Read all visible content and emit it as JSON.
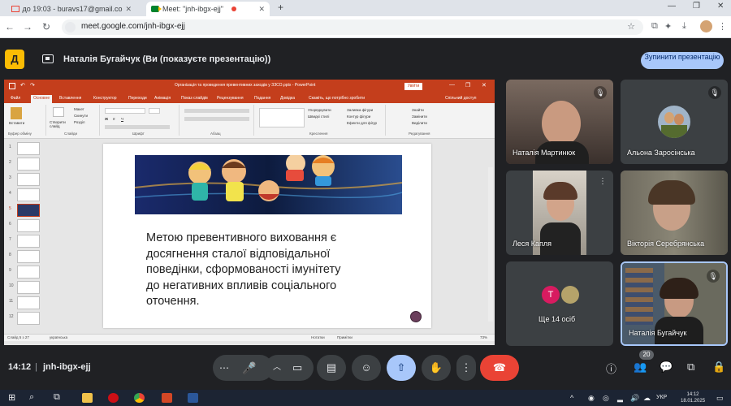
{
  "browser": {
    "tabs": [
      {
        "title": "до 19:03 - buravs17@gmail.co",
        "active": false
      },
      {
        "title": "Meet: \"jnh-ibgx-ejj\"",
        "active": true
      }
    ],
    "new_tab": "+",
    "url": "meet.google.com/jnh-ibgx-ejj"
  },
  "meet": {
    "logo_letter": "Д",
    "presenter_label": "Наталія Бугайчук (Ви (показуєте презентацію))",
    "stop_button": "Зупинити презентацію",
    "time": "14:12",
    "separator": "|",
    "meeting_code": "jnh-ibgx-ejj",
    "participants_badge": "20"
  },
  "powerpoint": {
    "title": "Організація та проведення превентивних заходів у ЗЗСО.pptx - PowerPoint",
    "sign_in": "Увійти",
    "tabs": [
      "Файл",
      "Основне",
      "Вставлення",
      "Конструктор",
      "Переходи",
      "Анімація",
      "Показ слайдів",
      "Рецензування",
      "Подання",
      "Довідка",
      "Скажіть, що потрібно зробити",
      "Спільний доступ"
    ],
    "ribbon_groups": [
      "Буфер обміну",
      "Слайди",
      "Шрифт",
      "Абзац",
      "Креслення",
      "Редагування"
    ],
    "ribbon_items": {
      "paste": "Вставити",
      "new_slide": "Створити слайд",
      "layout": "Макет",
      "reset": "Скинути",
      "section": "Розділ",
      "arrange": "Упорядкувати",
      "quick_styles": "Швидкі стилі",
      "fill": "Заливка фігури",
      "outline": "Контур фігури",
      "effects": "Ефекти для фігур",
      "find": "Знайти",
      "replace": "Замінити",
      "select": "Виділити"
    },
    "thumb_numbers": [
      "1",
      "2",
      "3",
      "4",
      "5",
      "6",
      "7",
      "8",
      "9",
      "10",
      "11",
      "12"
    ],
    "slide_text": "Метою превентивного виховання є досягнення сталої відповідальної поведінки, сформованості імунітету до негативних впливів соціального оточення.",
    "status": {
      "slide": "Слайд 5 з 27",
      "lang": "українська",
      "notes": "Нотатки",
      "comments": "Примітки",
      "zoom": "73%"
    }
  },
  "participants": [
    {
      "name": "Наталія Мартинюк",
      "type": "video",
      "muted": true
    },
    {
      "name": "Альона Заросінська",
      "type": "avatar",
      "muted": true
    },
    {
      "name": "Леся Капля",
      "type": "video",
      "muted": false
    },
    {
      "name": "Вікторія Серебрянська",
      "type": "video",
      "muted": false
    },
    {
      "name": "Ще 14 осіб",
      "type": "group",
      "avatar_letter": "Т",
      "muted": false
    },
    {
      "name": "Наталія Бугайчук",
      "type": "video",
      "muted": true
    }
  ],
  "taskbar": {
    "lang": "УКР",
    "clock_time": "14:12",
    "clock_date": "18.01.2025"
  },
  "colors": {
    "meet_bg": "#202124",
    "accent_blue": "#a8c7fa",
    "end_call_red": "#ea4335",
    "ppt_red": "#c43e1c",
    "logo_yellow": "#fbbc04"
  }
}
